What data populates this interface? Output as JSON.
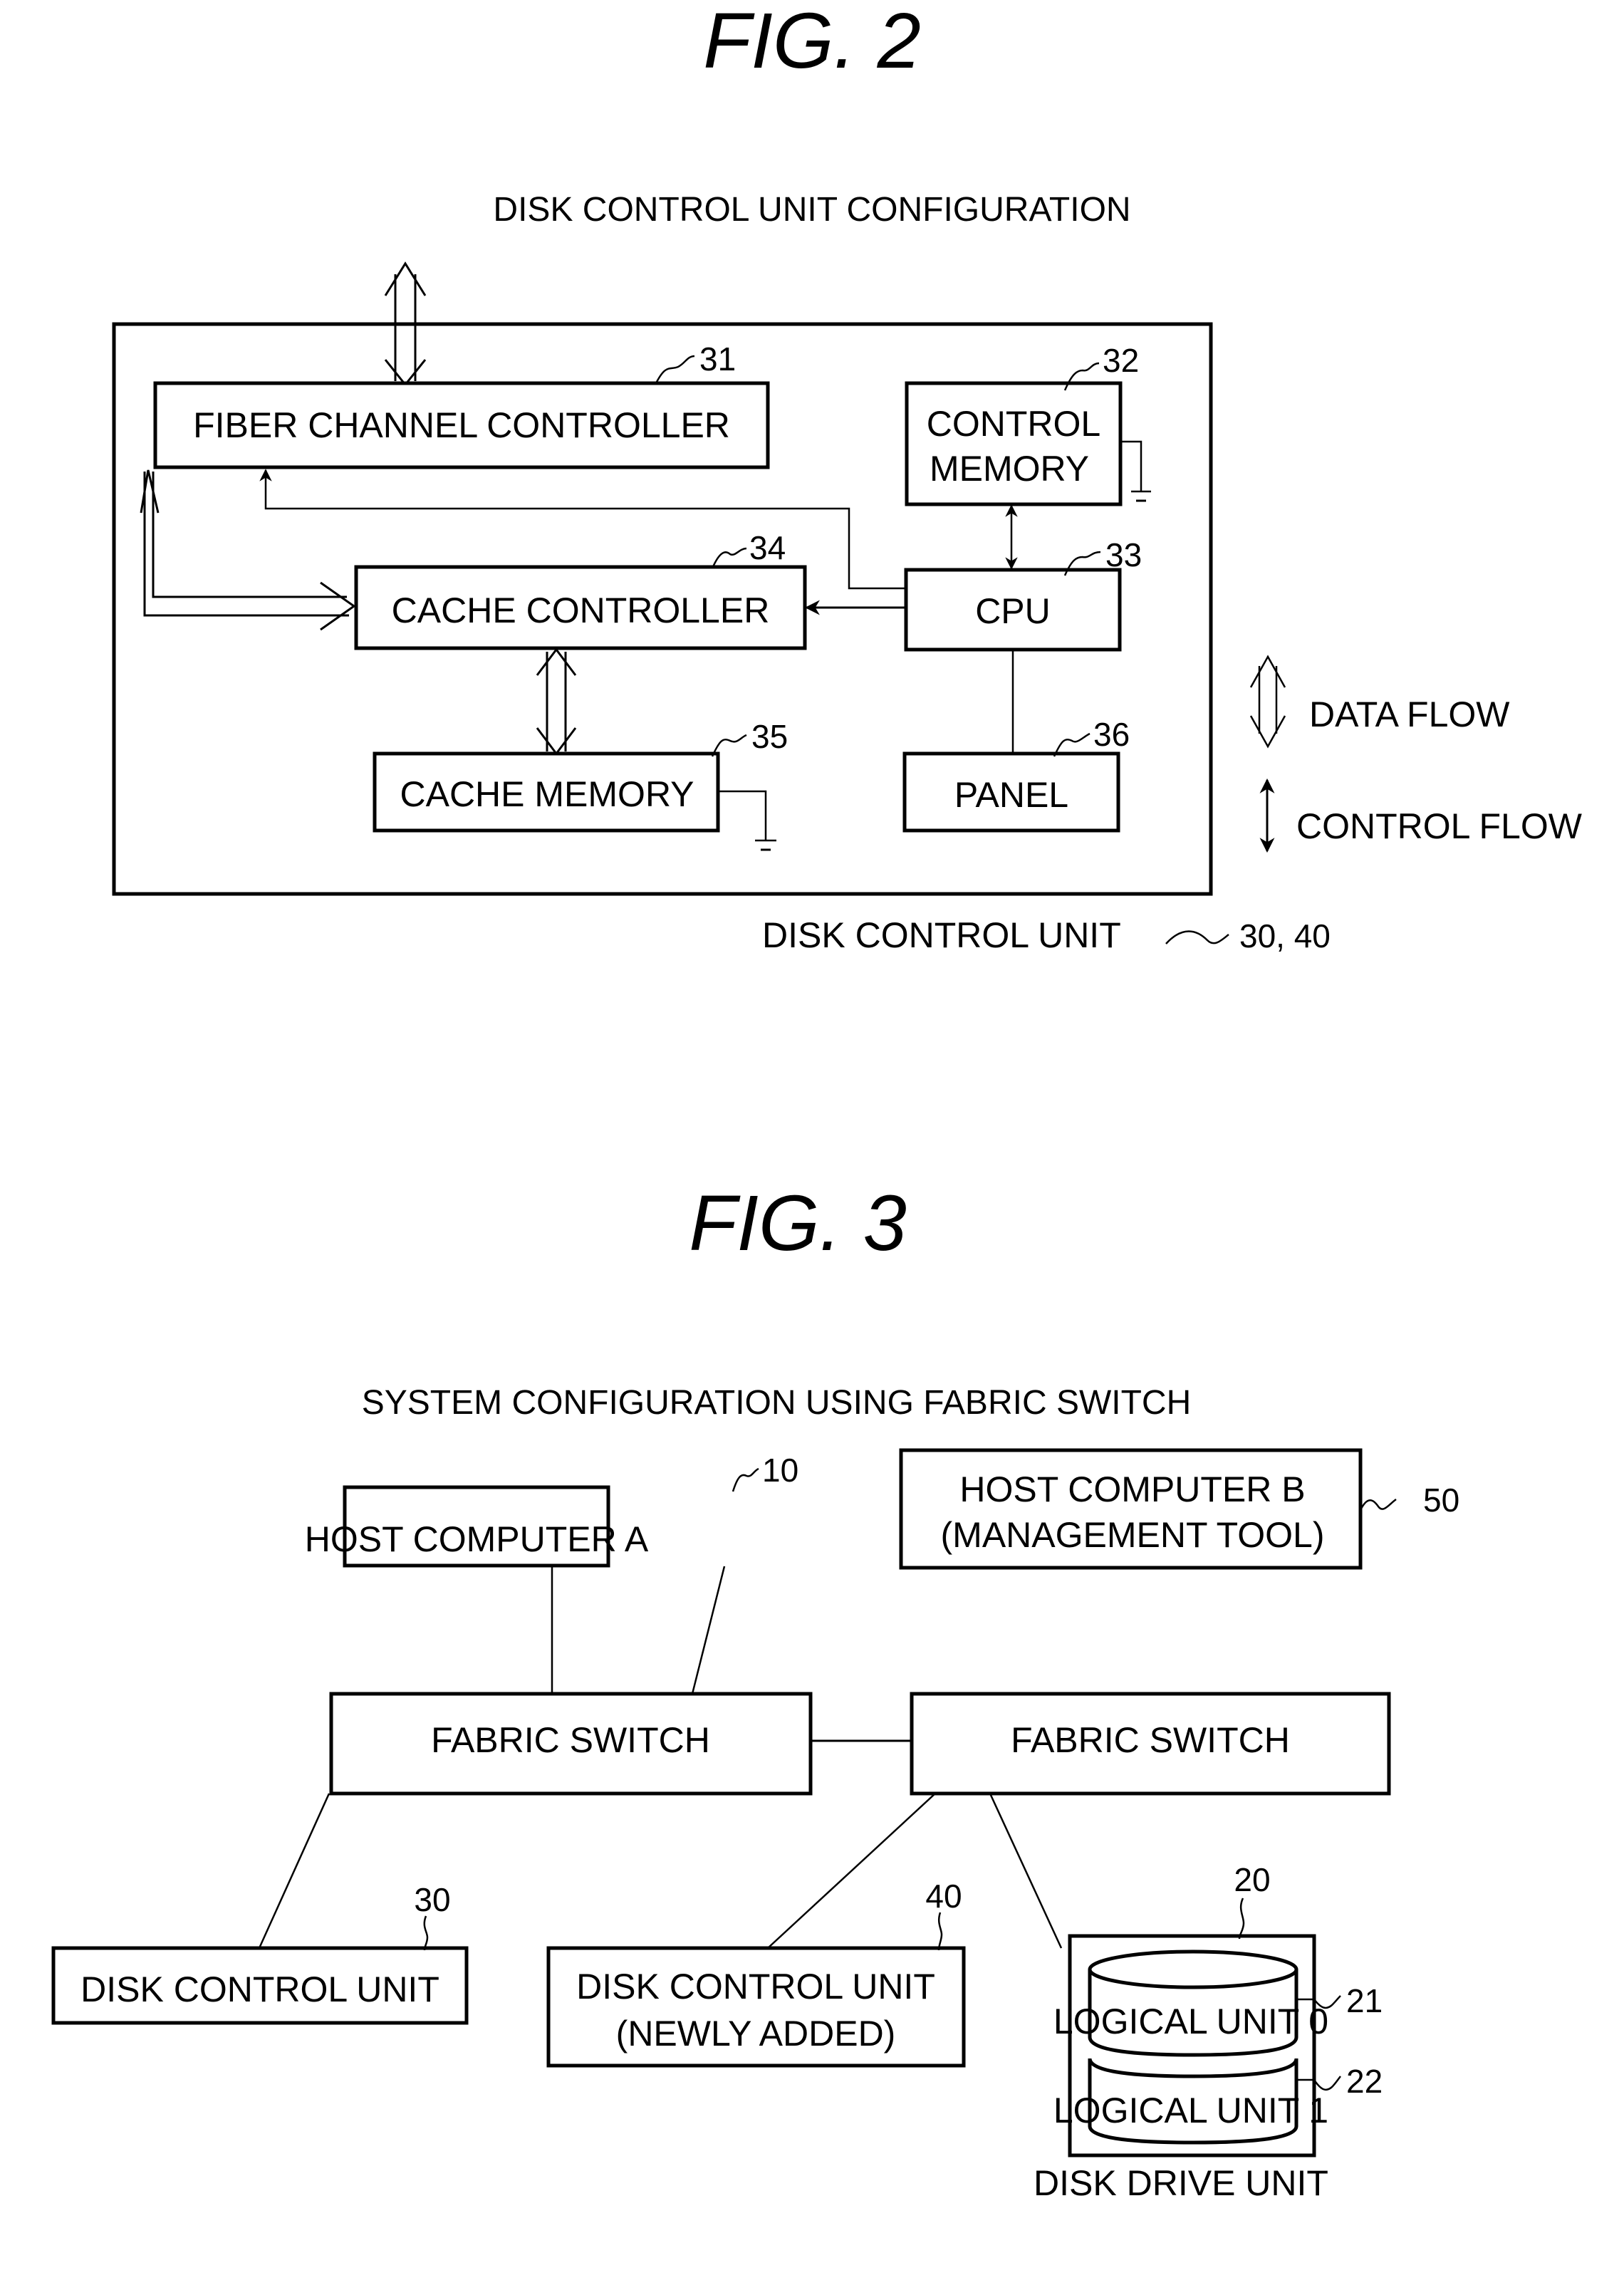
{
  "fig2": {
    "title": "FIG. 2",
    "caption": "DISK CONTROL UNIT CONFIGURATION",
    "blocks": {
      "fiber_channel_controller": {
        "label": "FIBER CHANNEL CONTROLLER",
        "ref": "31"
      },
      "control_memory": {
        "line1": "CONTROL",
        "line2": "MEMORY",
        "ref": "32"
      },
      "cpu": {
        "label": "CPU",
        "ref": "33"
      },
      "cache_controller": {
        "label": "CACHE CONTROLLER",
        "ref": "34"
      },
      "cache_memory": {
        "label": "CACHE MEMORY",
        "ref": "35"
      },
      "panel": {
        "label": "PANEL",
        "ref": "36"
      }
    },
    "enclosure": {
      "label": "DISK CONTROL UNIT",
      "ref": "30, 40"
    },
    "legend": [
      {
        "icon": "double-line-arrow-icon",
        "label": "DATA FLOW"
      },
      {
        "icon": "single-line-arrow-icon",
        "label": "CONTROL FLOW"
      }
    ]
  },
  "fig3": {
    "title": "FIG. 3",
    "caption": "SYSTEM CONFIGURATION USING FABRIC SWITCH",
    "nodes": {
      "host_a": {
        "label": "HOST COMPUTER A",
        "ref": "10"
      },
      "host_b": {
        "line1": "HOST COMPUTER B",
        "line2": "(MANAGEMENT TOOL)",
        "ref": "50"
      },
      "switch_left": {
        "label": "FABRIC SWITCH"
      },
      "switch_right": {
        "label": "FABRIC SWITCH"
      },
      "dcu_30": {
        "label": "DISK CONTROL UNIT",
        "ref": "30"
      },
      "dcu_40": {
        "line1": "DISK CONTROL UNIT",
        "line2": "(NEWLY ADDED)",
        "ref": "40"
      },
      "disk_drive": {
        "label": "DISK DRIVE UNIT",
        "ref": "20"
      },
      "lu0": {
        "label": "LOGICAL UNIT 0",
        "ref": "21"
      },
      "lu1": {
        "label": "LOGICAL UNIT 1",
        "ref": "22"
      }
    }
  }
}
